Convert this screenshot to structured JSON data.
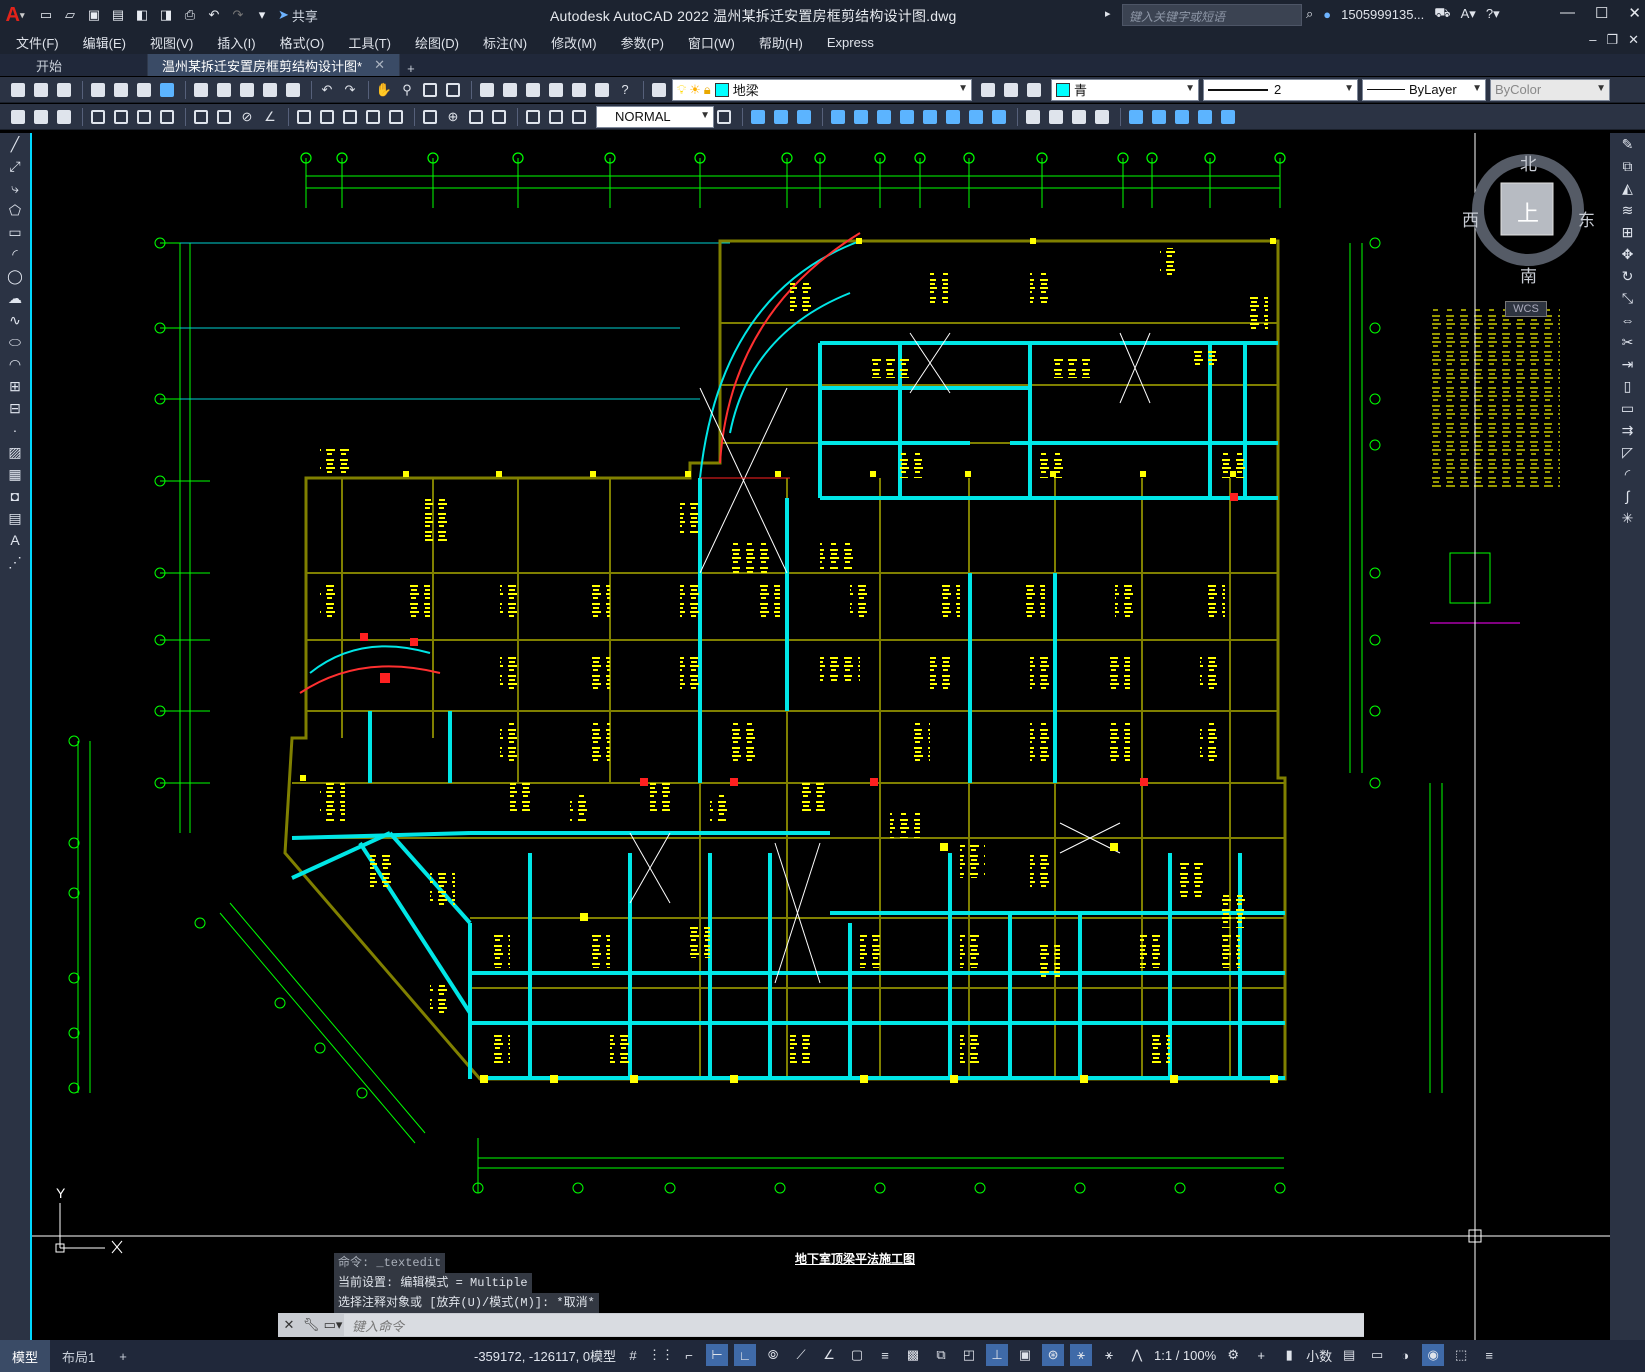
{
  "app": {
    "title": "Autodesk AutoCAD 2022    温州某拆迁安置房框剪结构设计图.dwg",
    "search_placeholder": "键入关键字或短语",
    "user": "1505999135...",
    "share_label": "共享"
  },
  "menu": [
    "文件(F)",
    "编辑(E)",
    "视图(V)",
    "插入(I)",
    "格式(O)",
    "工具(T)",
    "绘图(D)",
    "标注(N)",
    "修改(M)",
    "参数(P)",
    "窗口(W)",
    "帮助(H)",
    "Express"
  ],
  "tabs": [
    {
      "label": "开始",
      "active": false
    },
    {
      "label": "温州某拆迁安置房框剪结构设计图*",
      "active": true
    }
  ],
  "toolbar": {
    "layer_value": "地梁",
    "color_value": "青",
    "linetype_scale": "2",
    "lineweight": "ByLayer",
    "plotstyle": "ByColor",
    "dimstyle": "NORMAL"
  },
  "viewcube": {
    "north": "北",
    "south": "南",
    "east": "东",
    "west": "西",
    "top": "上",
    "wcs": "WCS"
  },
  "drawing": {
    "title": "地下室顶梁平法施工图"
  },
  "command": {
    "history": [
      "命令: _textedit",
      "当前设置: 编辑模式 = Multiple",
      "选择注释对象或 [放弃(U)/模式(M)]: *取消*"
    ],
    "placeholder": "键入命令"
  },
  "status": {
    "model_tab": "模型",
    "layout_tab": "布局1",
    "coords": "-359172, -126117, 0",
    "space": "模型",
    "scale": "1:1 / 100%",
    "units": "小数"
  },
  "colors": {
    "accent": "#3a4b66",
    "beam": "#00ffff",
    "wall": "#808000",
    "text": "#ffff00",
    "axis": "#00ff00"
  }
}
